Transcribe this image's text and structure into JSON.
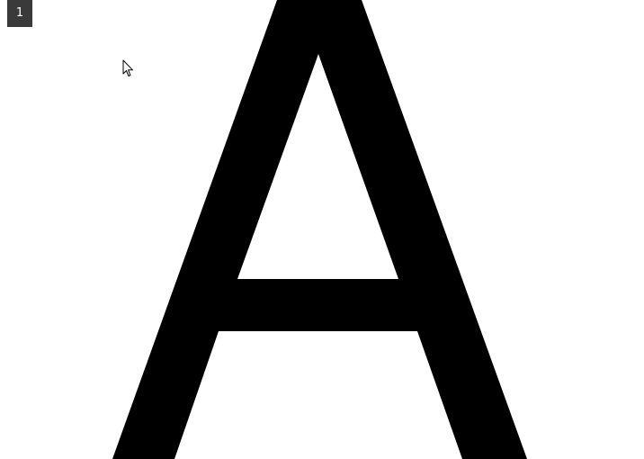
{
  "page_indicator": "1",
  "glyph": {
    "character": "A",
    "fill_color": "#000000"
  },
  "background_color": "#ffffff",
  "badge_color": "#3a3a3a",
  "cursor": {
    "icon": "arrow-pointer-icon"
  }
}
